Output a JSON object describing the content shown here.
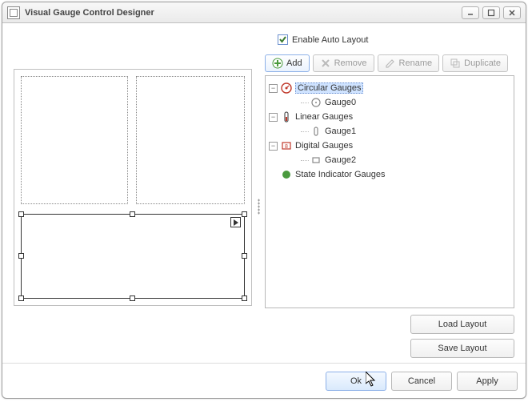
{
  "window": {
    "title": "Visual Gauge Control Designer"
  },
  "checkbox": {
    "label": "Enable Auto Layout",
    "checked": true
  },
  "toolbar": {
    "add": "Add",
    "remove": "Remove",
    "rename": "Rename",
    "duplicate": "Duplicate"
  },
  "tree": {
    "circular": {
      "label": "Circular Gauges",
      "children": [
        {
          "label": "Gauge0"
        }
      ]
    },
    "linear": {
      "label": "Linear Gauges",
      "children": [
        {
          "label": "Gauge1"
        }
      ]
    },
    "digital": {
      "label": "Digital Gauges",
      "children": [
        {
          "label": "Gauge2"
        }
      ]
    },
    "state": {
      "label": "State Indicator Gauges"
    }
  },
  "layout": {
    "load": "Load Layout",
    "save": "Save Layout"
  },
  "footer": {
    "ok": "Ok",
    "cancel": "Cancel",
    "apply": "Apply"
  }
}
